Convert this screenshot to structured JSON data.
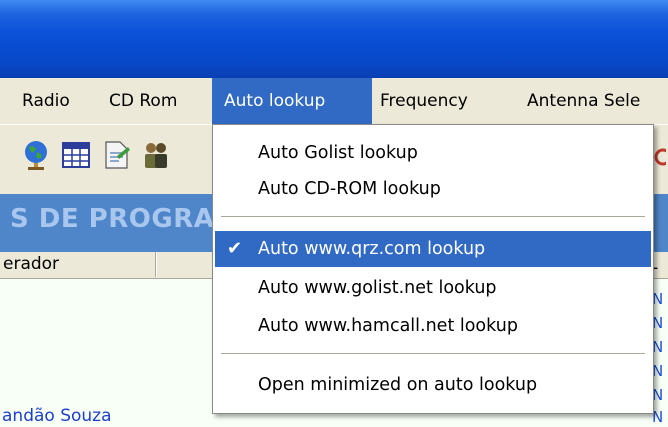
{
  "menubar": {
    "items": [
      "Radio",
      "CD Rom",
      "Auto lookup",
      "Frequency",
      "Antenna Sele"
    ],
    "active_index": 2
  },
  "toolbar": {
    "icons": [
      "globe-icon",
      "grid-icon",
      "document-icon",
      "people-icon"
    ]
  },
  "content": {
    "banner_text": "S DE PROGRAM",
    "columns": [
      "erador",
      "",
      "L"
    ],
    "rows": [
      {
        "flag": "N"
      },
      {
        "flag": "N"
      },
      {
        "flag": "N"
      },
      {
        "flag": "N"
      },
      {
        "flag": "N"
      },
      {
        "name": "andão Souza",
        "flag": "N"
      }
    ]
  },
  "dropdown": {
    "groups": [
      [
        "Auto Golist lookup",
        "Auto CD-ROM lookup"
      ],
      [
        "Auto www.qrz.com lookup",
        "Auto www.golist.net lookup",
        "Auto www.hamcall.net lookup"
      ],
      [
        "Open minimized on auto lookup"
      ]
    ],
    "checked_item": "Auto www.qrz.com lookup",
    "check_glyph": "✔"
  },
  "colors": {
    "titlebar": "#0a50d8",
    "selection": "#316ac5",
    "banner": "#4e86c9"
  }
}
